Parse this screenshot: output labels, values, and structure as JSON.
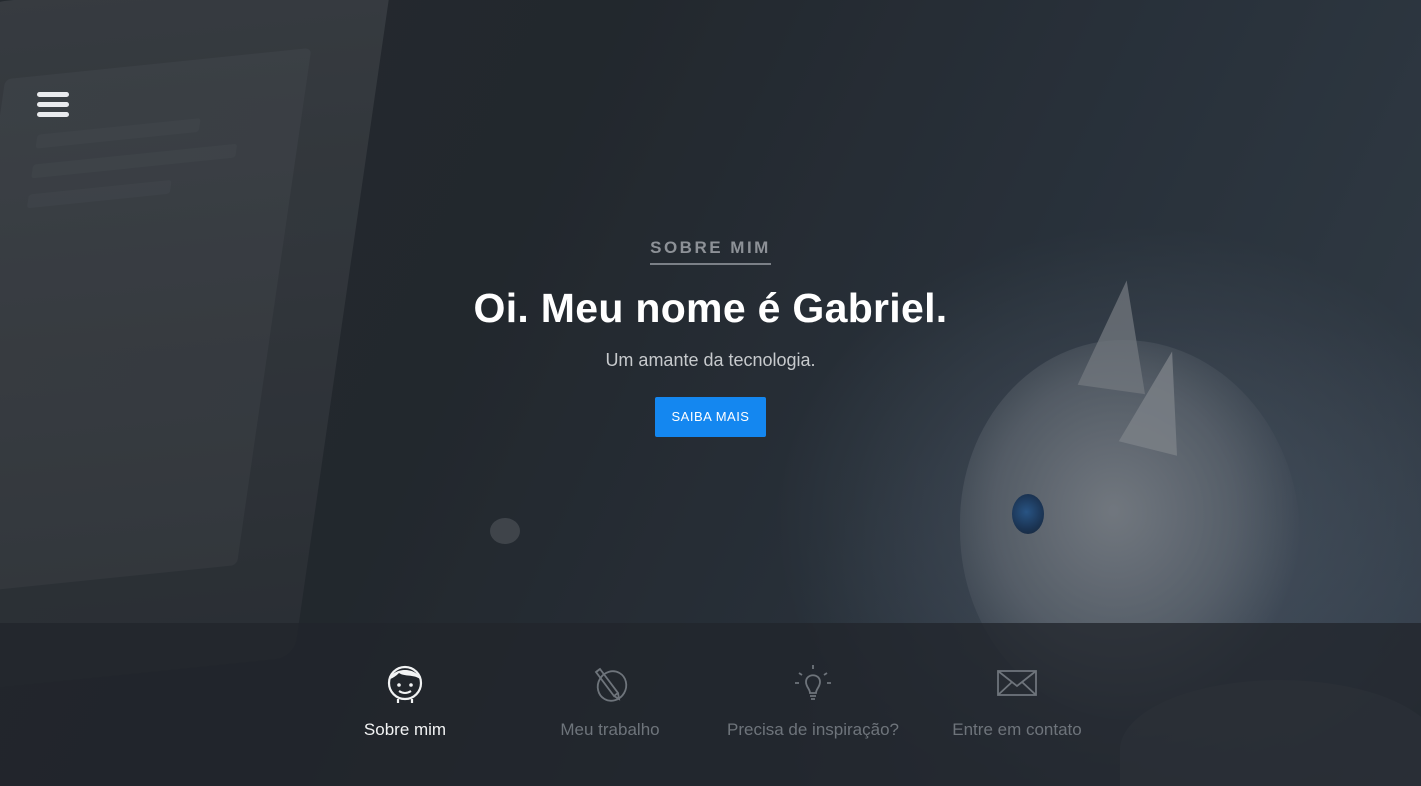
{
  "menu": {
    "icon": "hamburger-menu-icon"
  },
  "hero": {
    "eyebrow": "SOBRE MIM",
    "title": "Oi. Meu nome é Gabriel.",
    "subtitle": "Um amante da tecnologia.",
    "cta_label": "SAIBA MAIS",
    "cta_color": "#1487f0"
  },
  "nav": {
    "items": [
      {
        "label": "Sobre mim",
        "icon": "face-icon",
        "active": true
      },
      {
        "label": "Meu trabalho",
        "icon": "pencil-circle-icon",
        "active": false
      },
      {
        "label": "Precisa de inspiração?",
        "icon": "lightbulb-icon",
        "active": false
      },
      {
        "label": "Entre em contato",
        "icon": "envelope-icon",
        "active": false
      }
    ]
  }
}
